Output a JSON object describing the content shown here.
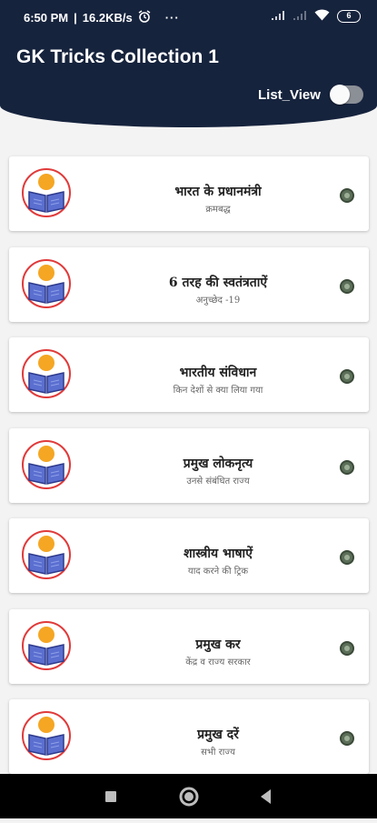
{
  "status_bar": {
    "time": "6:50 PM",
    "separator": "|",
    "speed": "16.2KB/s",
    "more": "···",
    "battery": "6"
  },
  "app": {
    "title": "GK Tricks Collection 1",
    "list_view_label": "List_View",
    "list_view_enabled": false
  },
  "items": [
    {
      "title": "भारत के प्रधानमंत्री",
      "subtitle": "क्रमबद्ध"
    },
    {
      "title": "6 तरह की स्वतंत्रताऐं",
      "subtitle": "अनुच्छेद -19"
    },
    {
      "title": "भारतीय संविधान",
      "subtitle": "किन देशों से क्या लिया गया"
    },
    {
      "title": "प्रमुख लोकनृत्य",
      "subtitle": "उनसे संबंधित राज्य"
    },
    {
      "title": "शास्त्रीय भाषाऐं",
      "subtitle": "याद करने की ट्रिक"
    },
    {
      "title": "प्रमुख कर",
      "subtitle": "केंद्र व राज्य सरकार"
    },
    {
      "title": "प्रमुख दरें",
      "subtitle": "सभी राज्य"
    }
  ],
  "colors": {
    "header": "#16233d",
    "avatar_ring": "#e03a3a",
    "book": "#5b6fd0",
    "person": "#f5a623"
  }
}
